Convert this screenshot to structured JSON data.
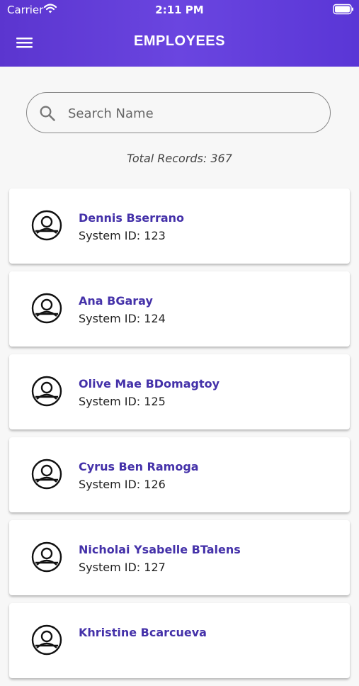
{
  "status_bar": {
    "carrier": "Carrier",
    "time": "2:11 PM"
  },
  "header": {
    "title": "EMPLOYEES",
    "menu_icon": "hamburger-menu-icon"
  },
  "search": {
    "placeholder": "Search Name",
    "value": "",
    "icon": "search-icon"
  },
  "summary": {
    "total_text": "Total Records: 367"
  },
  "employees": [
    {
      "name": "Dennis Bserrano",
      "id_text": "System ID: 123"
    },
    {
      "name": "Ana BGaray",
      "id_text": "System ID: 124"
    },
    {
      "name": "Olive Mae BDomagtoy",
      "id_text": "System ID: 125"
    },
    {
      "name": "Cyrus Ben Ramoga",
      "id_text": "System ID: 126"
    },
    {
      "name": "Nicholai Ysabelle BTalens",
      "id_text": "System ID: 127"
    },
    {
      "name": "Khristine Bcarcueva",
      "id_text": ""
    }
  ],
  "colors": {
    "header_gradient": [
      "#5b35cf",
      "#6a45e0"
    ],
    "name_color": "#4431a9",
    "background": "#f7f7f7"
  }
}
